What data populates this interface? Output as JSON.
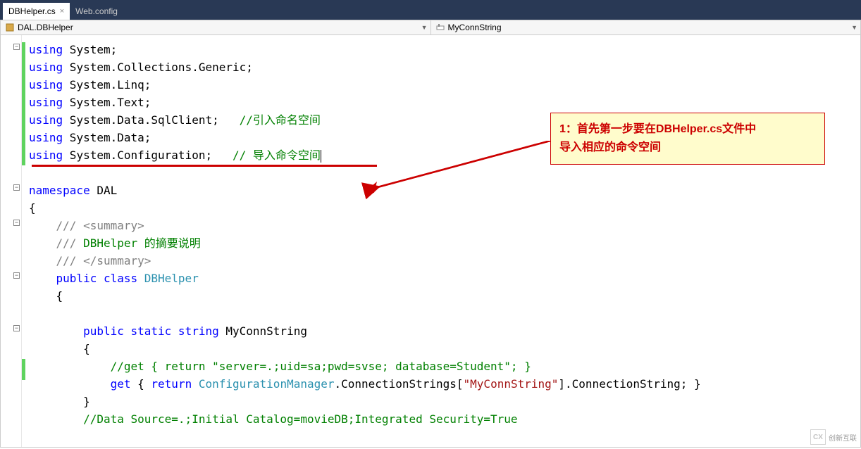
{
  "tabs": [
    {
      "label": "DBHelper.cs",
      "active": true,
      "close": "×"
    },
    {
      "label": "Web.config",
      "active": false,
      "close": ""
    }
  ],
  "breadcrumb": {
    "left": "DAL.DBHelper",
    "right": "MyConnString"
  },
  "callout": {
    "line1": "1：首先第一步要在DBHelper.cs文件中",
    "line2": "导入相应的命令空间"
  },
  "code": {
    "l1_kw": "using",
    "l1_ns": " System;",
    "l2_kw": "using",
    "l2_ns": " System.Collections.Generic;",
    "l3_kw": "using",
    "l3_ns": " System.Linq;",
    "l4_kw": "using",
    "l4_ns": " System.Text;",
    "l5_kw": "using",
    "l5_ns": " System.Data.SqlClient;   ",
    "l5_c": "//引入命名空间",
    "l6_kw": "using",
    "l6_ns": " System.Data;",
    "l7_kw": "using",
    "l7_ns": " System.Configuration;   ",
    "l7_c": "// 导入命令空间",
    "l9_kw": "namespace",
    "l9_ns": " DAL",
    "l10": "{",
    "l11_c": "    /// <summary>",
    "l12_c1": "    /// ",
    "l12_t": "DBHelper 的摘要说明",
    "l13_c": "    /// </summary>",
    "l14_in": "    ",
    "l14_kw1": "public",
    "l14_kw2": " class",
    "l14_t": " DBHelper",
    "l15": "    {",
    "l17_in": "        ",
    "l17_kw1": "public",
    "l17_kw2": " static",
    "l17_kw3": " string",
    "l17_n": " MyConnString",
    "l18": "        {",
    "l19_c": "            //get { return \"server=.;uid=sa;pwd=svse; database=Student\"; }",
    "l20_in": "            ",
    "l20_kw1": "get",
    "l20_b1": " { ",
    "l20_kw2": "return",
    "l20_sp": " ",
    "l20_t": "ConfigurationManager",
    "l20_r1": ".ConnectionStrings[",
    "l20_s": "\"MyConnString\"",
    "l20_r2": "].ConnectionString; }",
    "l21": "        }",
    "l22_c": "        //Data Source=.;Initial Catalog=movieDB;Integrated Security=True"
  },
  "watermark": {
    "brand": "创新互联",
    "logo": "CX"
  }
}
